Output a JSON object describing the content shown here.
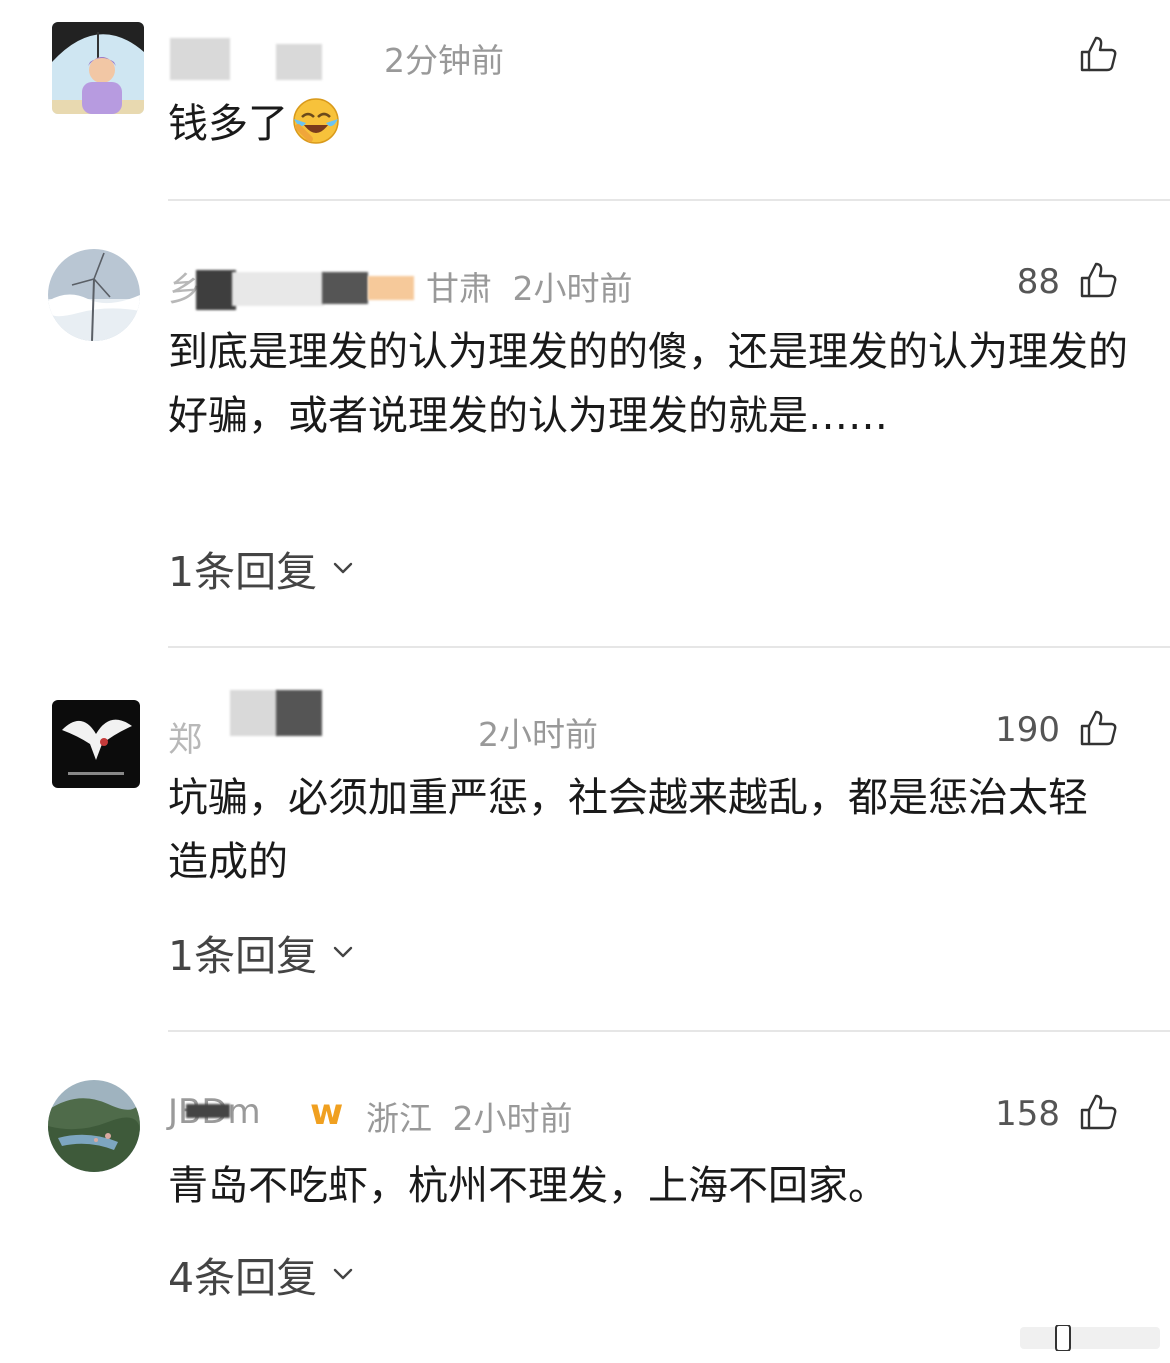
{
  "comments": [
    {
      "username": "",
      "location": "",
      "time": "2分钟前",
      "likes": "",
      "text": "钱多了",
      "emoji": "laughing-crying-emoji",
      "reply_label": ""
    },
    {
      "username": "乡",
      "location": "甘肃",
      "time": "2小时前",
      "likes": "88",
      "text": "到底是理发的认为理发的的傻，还是理发的认为理发的好骗，或者说理发的认为理发的就是……",
      "reply_label": "1条回复"
    },
    {
      "username": "郑",
      "location": "",
      "time": "2小时前",
      "likes": "190",
      "text": "坑骗，必须加重严惩，社会越来越乱，都是惩治太轻造成的",
      "reply_label": "1条回复"
    },
    {
      "username": "JBDm",
      "badge": "w",
      "location": "浙江",
      "time": "2小时前",
      "likes": "158",
      "text": "青岛不吃虾，杭州不理发，上海不回家。",
      "reply_label": "4条回复"
    }
  ],
  "icons": {
    "like": "thumbs-up-icon",
    "expand": "chevron-down-icon"
  },
  "colors": {
    "text": "#1a1a1a",
    "meta": "#999999",
    "divider": "#e6e6e6",
    "badge": "#f0a020"
  }
}
